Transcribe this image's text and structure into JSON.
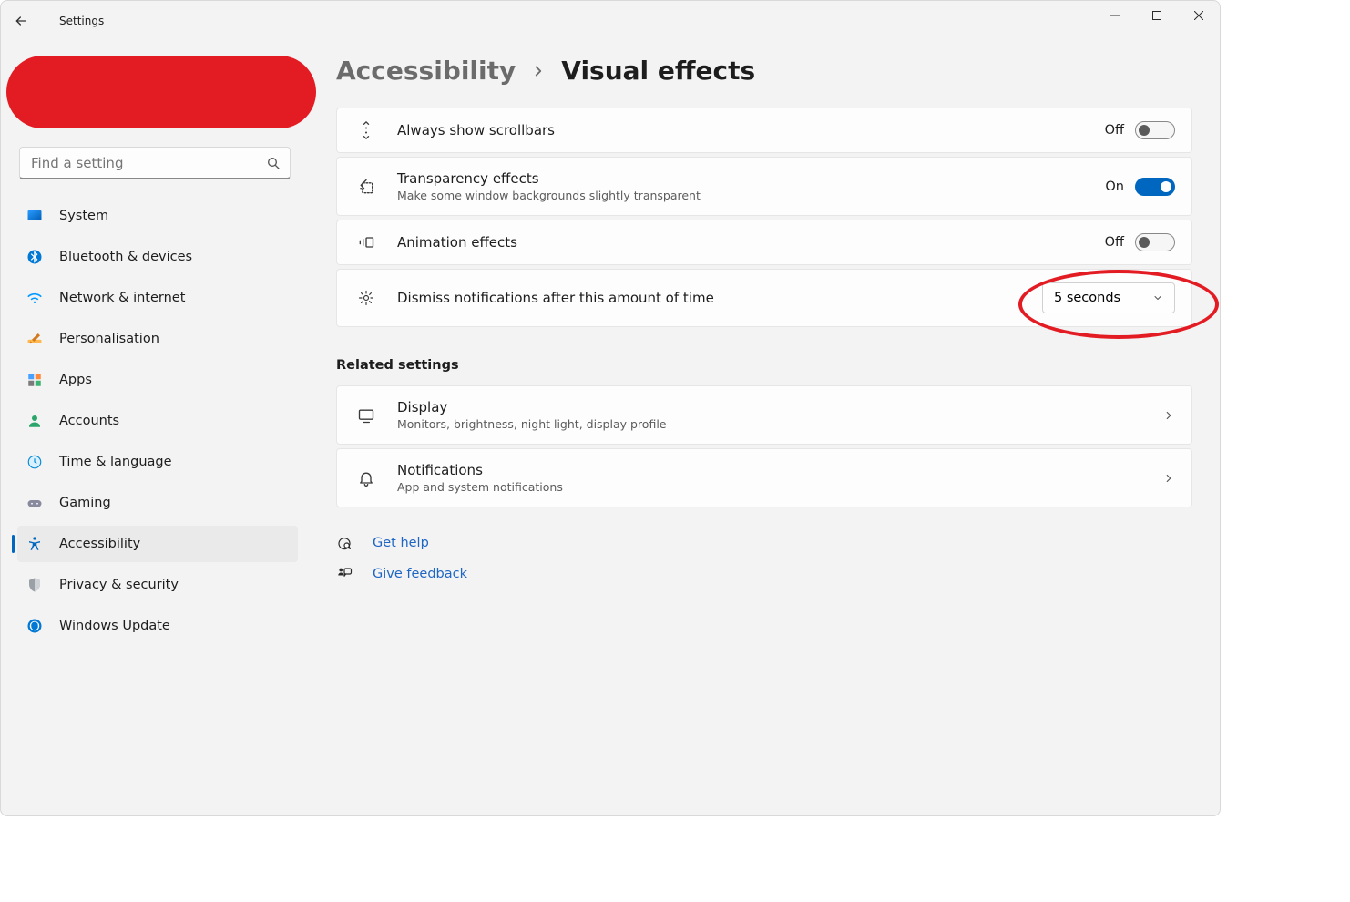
{
  "window": {
    "title": "Settings"
  },
  "sidebar": {
    "search_placeholder": "Find a setting",
    "items": [
      {
        "id": "system",
        "label": "System"
      },
      {
        "id": "bluetooth",
        "label": "Bluetooth & devices"
      },
      {
        "id": "network",
        "label": "Network & internet"
      },
      {
        "id": "personalisation",
        "label": "Personalisation"
      },
      {
        "id": "apps",
        "label": "Apps"
      },
      {
        "id": "accounts",
        "label": "Accounts"
      },
      {
        "id": "time",
        "label": "Time & language"
      },
      {
        "id": "gaming",
        "label": "Gaming"
      },
      {
        "id": "accessibility",
        "label": "Accessibility"
      },
      {
        "id": "privacy",
        "label": "Privacy & security"
      },
      {
        "id": "update",
        "label": "Windows Update"
      }
    ],
    "selected_id": "accessibility"
  },
  "breadcrumb": {
    "parent": "Accessibility",
    "current": "Visual effects"
  },
  "settings": {
    "scrollbars": {
      "title": "Always show scrollbars",
      "state": "Off"
    },
    "transparency": {
      "title": "Transparency effects",
      "sub": "Make some window backgrounds slightly transparent",
      "state": "On"
    },
    "animation": {
      "title": "Animation effects",
      "state": "Off"
    },
    "dismiss": {
      "title": "Dismiss notifications after this amount of time",
      "value": "5 seconds"
    }
  },
  "related": {
    "heading": "Related settings",
    "display": {
      "title": "Display",
      "sub": "Monitors, brightness, night light, display profile"
    },
    "notifications": {
      "title": "Notifications",
      "sub": "App and system notifications"
    }
  },
  "links": {
    "help": "Get help",
    "feedback": "Give feedback"
  }
}
